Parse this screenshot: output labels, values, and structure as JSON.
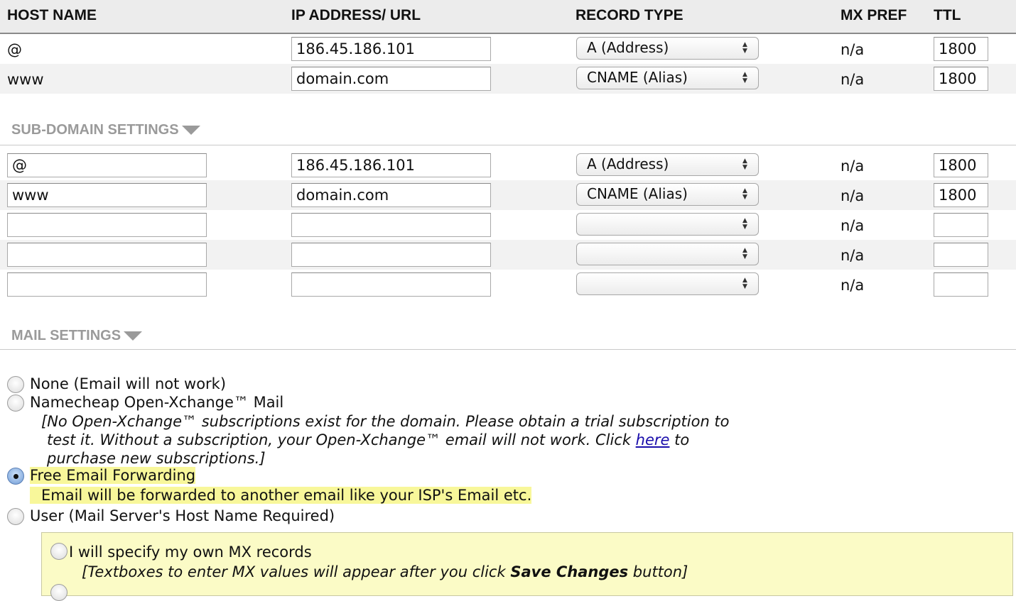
{
  "header": {
    "host_name": "HOST NAME",
    "ip_address": "IP ADDRESS/ URL",
    "record_type": "RECORD TYPE",
    "mx_pref": "MX PREF",
    "ttl": "TTL"
  },
  "host_records": [
    {
      "host": "@",
      "ip": "186.45.186.101",
      "record_type": "A (Address)",
      "mx_pref": "n/a",
      "ttl": "1800"
    },
    {
      "host": "www",
      "ip": "domain.com",
      "record_type": "CNAME (Alias)",
      "mx_pref": "n/a",
      "ttl": "1800"
    }
  ],
  "subdomain": {
    "title": "SUB-DOMAIN SETTINGS",
    "rows": [
      {
        "host": "@",
        "ip": "186.45.186.101",
        "record_type": "A (Address)",
        "mx_pref": "n/a",
        "ttl": "1800"
      },
      {
        "host": "www",
        "ip": "domain.com",
        "record_type": "CNAME (Alias)",
        "mx_pref": "n/a",
        "ttl": "1800"
      },
      {
        "host": "",
        "ip": "",
        "record_type": "",
        "mx_pref": "n/a",
        "ttl": ""
      },
      {
        "host": "",
        "ip": "",
        "record_type": "",
        "mx_pref": "n/a",
        "ttl": ""
      },
      {
        "host": "",
        "ip": "",
        "record_type": "",
        "mx_pref": "n/a",
        "ttl": ""
      }
    ]
  },
  "mail": {
    "title": "MAIL SETTINGS",
    "none_label": "None (Email will not work)",
    "ox_label": "Namecheap Open-Xchange™ Mail",
    "ox_note_1": "[No Open-Xchange™ subscriptions exist for the domain. Please obtain a trial subscription to",
    "ox_note_2a": "test it. Without a subscription, your Open-Xchange™ email will not work. Click ",
    "ox_note_link": "here",
    "ox_note_2b": " to",
    "ox_note_3": "purchase new subscriptions.]",
    "forward_label": "Free Email Forwarding",
    "forward_note": "Email will be forwarded to another email like your ISP's Email etc.",
    "user_label": "User (Mail Server's Host Name Required)",
    "mx_label": "I will specify my own MX records",
    "mx_note_a": "[Textboxes to enter MX values will appear after you click ",
    "mx_note_bold": "Save Changes",
    "mx_note_b": " button]",
    "selected": "forward"
  },
  "colors": {
    "highlight": "#f8f79a",
    "link": "#1a0dab",
    "section_title": "#9a9a9a"
  }
}
